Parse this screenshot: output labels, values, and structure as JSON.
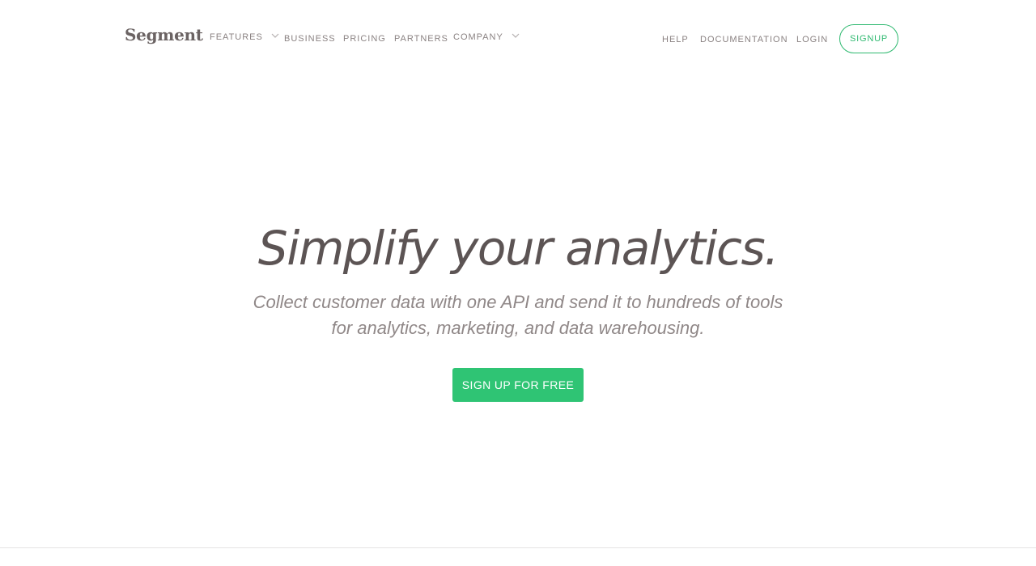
{
  "header": {
    "logo": "Segment",
    "nav_left": [
      {
        "label": "FEATURES",
        "has_dropdown": true
      },
      {
        "label": "BUSINESS",
        "has_dropdown": false
      },
      {
        "label": "PRICING",
        "has_dropdown": false
      },
      {
        "label": "PARTNERS",
        "has_dropdown": false
      },
      {
        "label": "COMPANY",
        "has_dropdown": true
      }
    ],
    "nav_right": [
      {
        "label": "HELP"
      },
      {
        "label": "DOCUMENTATION"
      },
      {
        "label": "LOGIN"
      }
    ],
    "signup_label": "SIGNUP"
  },
  "hero": {
    "title": "Simplify your analytics.",
    "subtitle_line1": "Collect customer data with one API and send it to hundreds of tools",
    "subtitle_line2": "for analytics, marketing, and data warehousing.",
    "cta_label": "SIGN UP FOR FREE"
  },
  "colors": {
    "accent_green": "#2fc474",
    "outline_green": "#2fb970",
    "text_primary": "#5c5454",
    "text_muted": "#908888"
  },
  "icons": {
    "dropdown": "chevron-down-icon"
  }
}
